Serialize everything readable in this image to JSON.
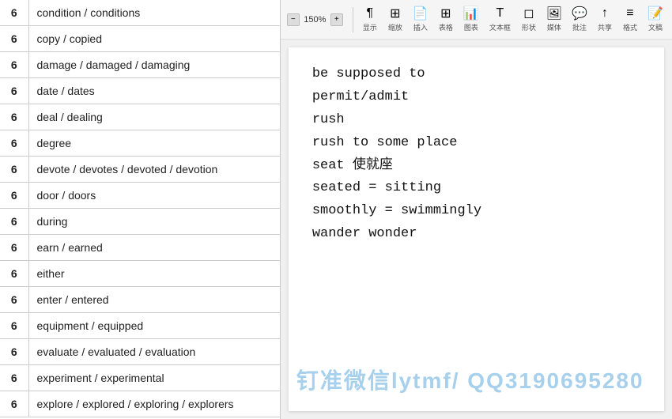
{
  "toolbar": {
    "zoom_value": "150%",
    "items": [
      {
        "label": "显示",
        "icon": "grid"
      },
      {
        "label": "缩放",
        "icon": "zoom"
      },
      {
        "label": "插入",
        "icon": "insert"
      },
      {
        "label": "表格",
        "icon": "table"
      },
      {
        "label": "图表",
        "icon": "chart"
      },
      {
        "label": "文本框",
        "icon": "text"
      },
      {
        "label": "形状",
        "icon": "shape"
      },
      {
        "label": "媒体",
        "icon": "media"
      },
      {
        "label": "批注",
        "icon": "comment"
      },
      {
        "label": "共享",
        "icon": "share"
      },
      {
        "label": "格式",
        "icon": "format"
      },
      {
        "label": "文稿",
        "icon": "doc"
      }
    ]
  },
  "vocab_table": {
    "rows": [
      {
        "level": "6",
        "word": "condition / conditions"
      },
      {
        "level": "6",
        "word": "copy / copied"
      },
      {
        "level": "6",
        "word": "damage / damaged / damaging"
      },
      {
        "level": "6",
        "word": "date / dates"
      },
      {
        "level": "6",
        "word": "deal / dealing"
      },
      {
        "level": "6",
        "word": "degree"
      },
      {
        "level": "6",
        "word": "devote / devotes / devoted / devotion"
      },
      {
        "level": "6",
        "word": "door / doors"
      },
      {
        "level": "6",
        "word": "during"
      },
      {
        "level": "6",
        "word": "earn / earned"
      },
      {
        "level": "6",
        "word": "either"
      },
      {
        "level": "6",
        "word": "enter / entered"
      },
      {
        "level": "6",
        "word": "equipment / equipped"
      },
      {
        "level": "6",
        "word": "evaluate / evaluated / evaluation"
      },
      {
        "level": "6",
        "word": "experiment / experimental"
      },
      {
        "level": "6",
        "word": "explore / explored / exploring / explorers"
      }
    ]
  },
  "doc": {
    "lines": [
      "be supposed to",
      "permit/admit",
      "rush",
      "rush to some place",
      "seat 使就座",
      "seated = sitting",
      "smoothly  = swimmingly",
      "wander  wonder"
    ]
  },
  "watermark": {
    "text": "钉准微信lytmf/ QQ3190695280"
  }
}
